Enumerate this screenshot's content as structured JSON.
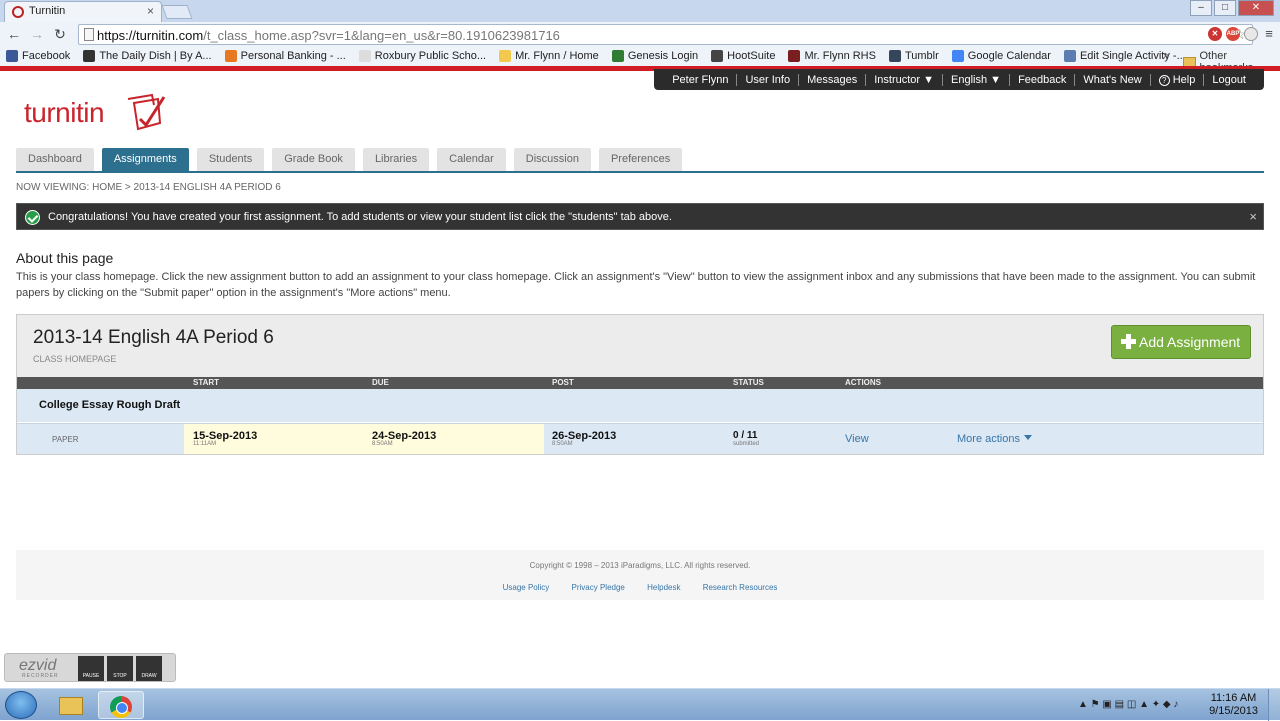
{
  "browser": {
    "tab_title": "Turnitin",
    "tab_close": "×",
    "url_host": "https://turnitin.com",
    "url_path": "/t_class_home.asp?svr=1&lang=en_us&r=80.1910623981716",
    "bookmarks": [
      {
        "label": "Facebook",
        "color": "#3b5998"
      },
      {
        "label": "The Daily Dish | By A...",
        "color": "#333333"
      },
      {
        "label": "Personal Banking - ...",
        "color": "#e87722"
      },
      {
        "label": "Roxbury Public Scho...",
        "color": "#dddddd"
      },
      {
        "label": "Mr. Flynn / Home",
        "color": "#f2c94c"
      },
      {
        "label": "Genesis Login",
        "color": "#2e7d32"
      },
      {
        "label": "HootSuite",
        "color": "#444444"
      },
      {
        "label": "Mr. Flynn RHS",
        "color": "#7a1f1f"
      },
      {
        "label": "Tumblr",
        "color": "#35465c"
      },
      {
        "label": "Google Calendar",
        "color": "#4285f4"
      },
      {
        "label": "Edit Single Activity -...",
        "color": "#5b7db1"
      }
    ],
    "bookmarks_more": "»",
    "other_bookmarks": "Other bookmarks"
  },
  "topnav": {
    "user": "Peter Flynn",
    "user_info": "User Info",
    "messages": "Messages",
    "instructor": "Instructor ▼",
    "language": "English ▼",
    "feedback": "Feedback",
    "whats_new": "What's New",
    "help": "Help",
    "logout": "Logout"
  },
  "logo_text": "turnitin",
  "tabs": [
    "Dashboard",
    "Assignments",
    "Students",
    "Grade Book",
    "Libraries",
    "Calendar",
    "Discussion",
    "Preferences"
  ],
  "breadcrumb": "NOW VIEWING: HOME > 2013-14 ENGLISH 4A PERIOD 6",
  "notice": "Congratulations! You have created your first assignment. To add students or view your student list click the \"students\" tab above.",
  "notice_close": "×",
  "about": {
    "title": "About this page",
    "text": "This is your class homepage. Click the new assignment button to add an assignment to your class homepage. Click an assignment's \"View\" button to view the assignment inbox and any submissions that have been made to the assignment. You can submit papers by clicking on the \"Submit paper\" option in the assignment's \"More actions\" menu."
  },
  "class": {
    "title": "2013-14 English 4A Period 6",
    "subtitle": "CLASS HOMEPAGE",
    "add_button": "Add Assignment"
  },
  "table": {
    "columns": {
      "start": "START",
      "due": "DUE",
      "post": "POST",
      "status": "STATUS",
      "actions": "ACTIONS"
    },
    "assignment": {
      "name": "College Essay Rough Draft",
      "type": "PAPER",
      "start_date": "15-Sep-2013",
      "start_time": "11:11AM",
      "due_date": "24-Sep-2013",
      "due_time": "8:50AM",
      "post_date": "26-Sep-2013",
      "post_time": "8:50AM",
      "status": "0 / 11",
      "status_sub": "submitted",
      "view": "View",
      "more_actions": "More actions"
    }
  },
  "footer": {
    "copyright": "Copyright © 1998 – 2013 iParadigms, LLC. All rights reserved.",
    "links": [
      "Usage Policy",
      "Privacy Pledge",
      "Helpdesk",
      "Research Resources"
    ]
  },
  "ezvid": {
    "logo": "ezvid",
    "sub": "RECORDER",
    "pause": "PAUSE",
    "stop": "STOP",
    "draw": "DRAW"
  },
  "taskbar": {
    "time": "11:16 AM",
    "date": "9/15/2013"
  }
}
